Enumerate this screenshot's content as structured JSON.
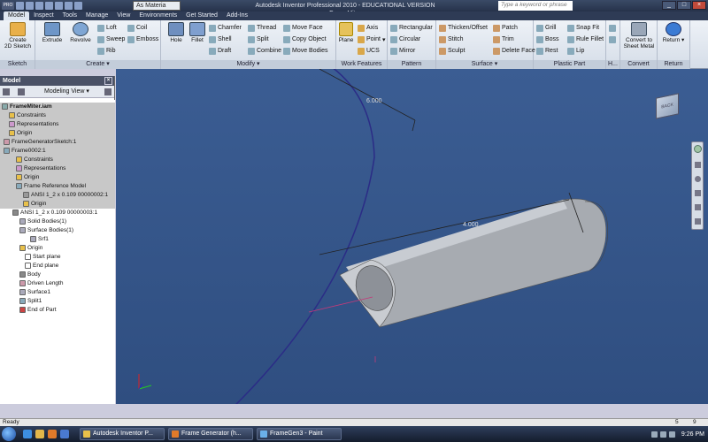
{
  "window": {
    "title": "Autodesk Inventor Professional 2010 - EDUCATIONAL VERSION   FrameMiter",
    "material": "As Materia",
    "search_placeholder": "Type a keyword or phrase",
    "pro_badge": "PRO"
  },
  "tabs": [
    {
      "label": "Model",
      "active": true
    },
    {
      "label": "Inspect"
    },
    {
      "label": "Tools"
    },
    {
      "label": "Manage"
    },
    {
      "label": "View"
    },
    {
      "label": "Environments"
    },
    {
      "label": "Get Started"
    },
    {
      "label": "Add-Ins"
    }
  ],
  "ribbon": {
    "sketch": {
      "title": "Sketch",
      "create_sketch": "Create\n2D Sketch"
    },
    "create": {
      "title": "Create",
      "extrude": "Extrude",
      "revolve": "Revolve",
      "loft": "Loft",
      "sweep": "Sweep",
      "rib": "Rib",
      "coil": "Coil",
      "emboss": "Emboss"
    },
    "modify": {
      "title": "Modify",
      "hole": "Hole",
      "fillet": "Fillet",
      "chamfer": "Chamfer",
      "shell": "Shell",
      "draft": "Draft",
      "thread": "Thread",
      "split": "Split",
      "combine": "Combine",
      "move_face": "Move Face",
      "copy_object": "Copy Object",
      "move_bodies": "Move Bodies"
    },
    "work_features": {
      "title": "Work Features",
      "plane": "Plane",
      "axis": "Axis",
      "point": "Point",
      "ucs": "UCS"
    },
    "pattern": {
      "title": "Pattern",
      "rectangular": "Rectangular",
      "circular": "Circular",
      "mirror": "Mirror"
    },
    "surface": {
      "title": "Surface",
      "thicken_offset": "Thicken/Offset",
      "stitch": "Stitch",
      "sculpt": "Sculpt",
      "patch": "Patch",
      "trim": "Trim",
      "delete_face": "Delete Face"
    },
    "plastic_part": {
      "title": "Plastic Part",
      "grill": "Grill",
      "boss": "Boss",
      "rest": "Rest",
      "snap_fit": "Snap Fit",
      "rule_fillet": "Rule Fillet",
      "lip": "Lip"
    },
    "harness": {
      "title": "H..."
    },
    "convert": {
      "title": "Convert",
      "convert_sheet_metal": "Convert to\nSheet Metal"
    },
    "return": {
      "title": "Return",
      "return": "Return"
    }
  },
  "browser": {
    "title": "Model",
    "view_mode": "Modeling View",
    "items": [
      {
        "label": "FrameMiter.iam",
        "bold": true
      },
      {
        "label": "Constraints"
      },
      {
        "label": "Representations"
      },
      {
        "label": "Origin"
      },
      {
        "label": "FrameGeneratorSketch:1"
      },
      {
        "label": "Frame0002:1"
      },
      {
        "label": "Constraints"
      },
      {
        "label": "Representations"
      },
      {
        "label": "Origin"
      },
      {
        "label": "Frame Reference Model"
      },
      {
        "label": "ANSI 1_2 x 0.109 00000002:1"
      },
      {
        "label": "Origin"
      },
      {
        "label": "ANSI 1_2 x 0.109 00000003:1"
      },
      {
        "label": "Solid Bodies(1)"
      },
      {
        "label": "Surface Bodies(1)"
      },
      {
        "label": "Srf1"
      },
      {
        "label": "Origin"
      },
      {
        "label": "Start plane"
      },
      {
        "label": "End plane"
      },
      {
        "label": "Body"
      },
      {
        "label": "Driven Length"
      },
      {
        "label": "Surface1"
      },
      {
        "label": "Split1"
      },
      {
        "label": "End of Part"
      }
    ]
  },
  "viewport": {
    "dim_top": "6.000",
    "dim_tube": "4.000",
    "viewcube_face": "BACK"
  },
  "status": {
    "text": "Ready",
    "count_a": "5",
    "count_b": "9"
  },
  "taskbar": {
    "items": [
      {
        "label": "Autodesk Inventor P..."
      },
      {
        "label": "Frame Generator (h..."
      },
      {
        "label": "FrameGen3 - Paint"
      }
    ],
    "clock": "9:26 PM"
  },
  "colors": {
    "viewport_bg": "#3a5b90",
    "titlebar_bg": "#2a3650",
    "selection_blue": "#2b2c86"
  }
}
